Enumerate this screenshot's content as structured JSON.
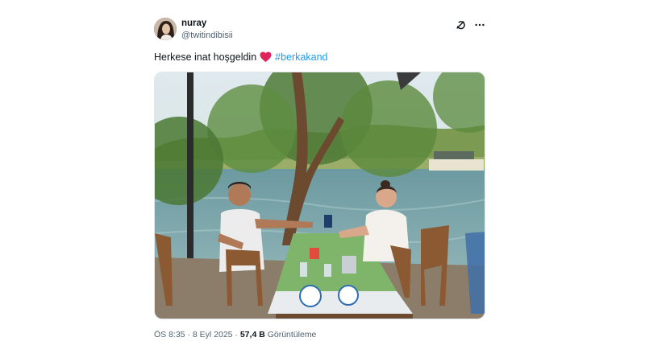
{
  "author": {
    "display_name": "nuray",
    "handle": "@twitindibisii"
  },
  "icons": {
    "grok": "grok-icon",
    "more": "more-icon",
    "heart": "heart-icon"
  },
  "post": {
    "text": "Herkese inat hoşgeldin",
    "hashtag": "#berkakand",
    "heart_color": "#e0245e",
    "hashtag_color": "#1d9bf0"
  },
  "meta": {
    "time": "ÖS 8:35",
    "sep1": "·",
    "date": "8 Eyl 2025",
    "sep2": "·",
    "views_count": "57,4 B",
    "views_label": "Görüntüleme"
  }
}
